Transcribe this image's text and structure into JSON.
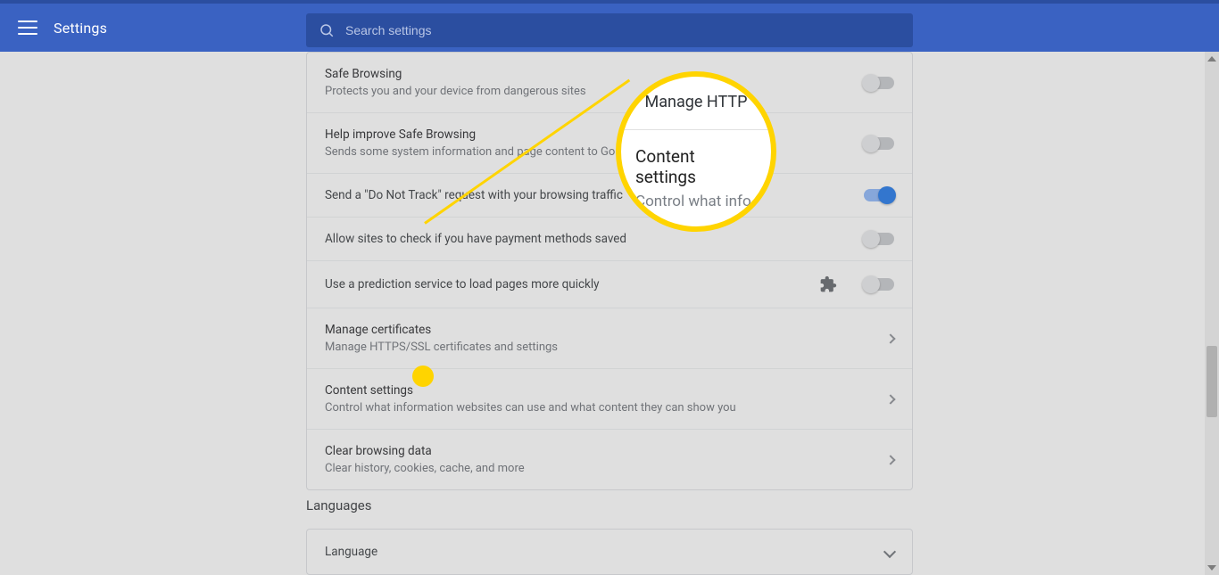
{
  "header": {
    "title": "Settings",
    "search_placeholder": "Search settings"
  },
  "privacy": {
    "safe_browsing": {
      "label": "Safe Browsing",
      "sub": "Protects you and your device from dangerous sites",
      "on": false
    },
    "help_improve": {
      "label": "Help improve Safe Browsing",
      "sub": "Sends some system information and page content to Go",
      "on": false
    },
    "dnt": {
      "label": "Send a \"Do Not Track\" request with your browsing traffic",
      "on": true
    },
    "payment": {
      "label": "Allow sites to check if you have payment methods saved",
      "on": false
    },
    "predict": {
      "label": "Use a prediction service to load pages more quickly",
      "on": false
    },
    "certs": {
      "label": "Manage certificates",
      "sub": "Manage HTTPS/SSL certificates and settings"
    },
    "content": {
      "label": "Content settings",
      "sub": "Control what information websites can use and what content they can show you"
    },
    "clear": {
      "label": "Clear browsing data",
      "sub": "Clear history, cookies, cache, and more"
    }
  },
  "languages": {
    "heading": "Languages",
    "row_label": "Language"
  },
  "callout": {
    "pre": "Manage HTTP",
    "title": "Content settings",
    "sub": "Control what info"
  }
}
